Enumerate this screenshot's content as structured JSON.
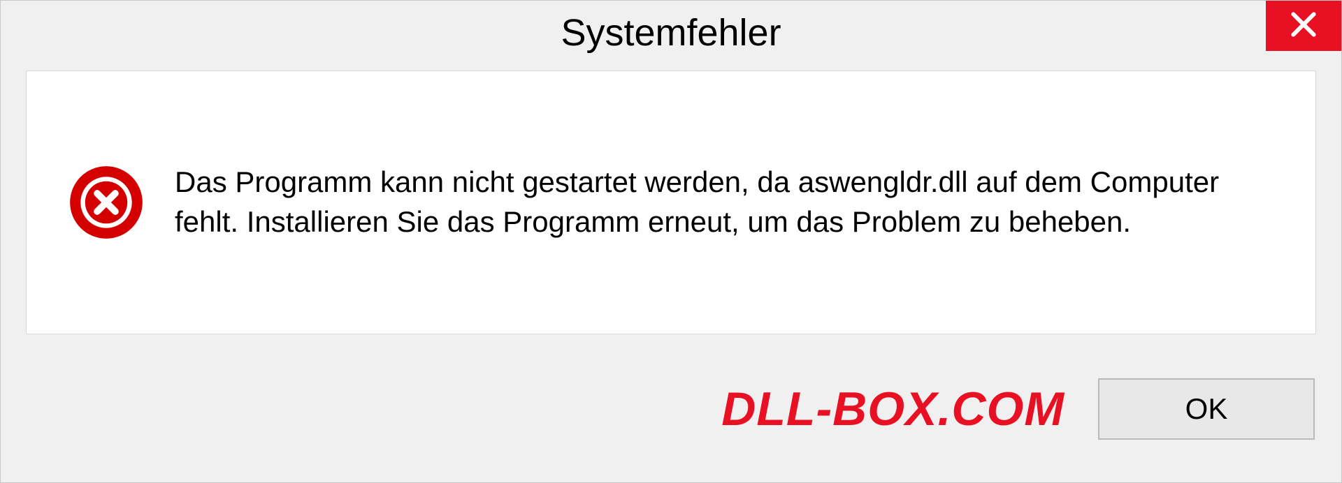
{
  "dialog": {
    "title": "Systemfehler",
    "message": "Das Programm kann nicht gestartet werden, da aswengldr.dll auf dem Computer fehlt. Installieren Sie das Programm erneut, um das Problem zu beheben.",
    "ok_label": "OK"
  },
  "watermark": "DLL-BOX.COM",
  "colors": {
    "close_bg": "#e81123",
    "error_red": "#d40000",
    "watermark_red": "#e81123"
  }
}
